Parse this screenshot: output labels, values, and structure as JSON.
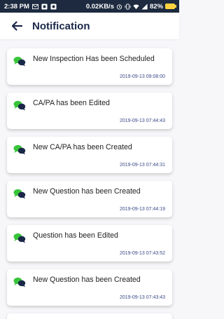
{
  "status_bar": {
    "time": "2:38 PM",
    "network_speed": "0.02KB/s",
    "battery": "82%"
  },
  "header": {
    "title": "Notification"
  },
  "notifications": [
    {
      "text": "New Inspection Has been Scheduled",
      "time": "2019-09-13 09:08:00"
    },
    {
      "text": "CA/PA has been Edited",
      "time": "2019-09-13 07:44:43"
    },
    {
      "text": "New CA/PA has been Created",
      "time": "2019-09-13 07:44:31"
    },
    {
      "text": "New Question has been Created",
      "time": "2019-09-13 07:44:19"
    },
    {
      "text": "Question has been Edited",
      "time": "2019-09-13 07:43:52"
    },
    {
      "text": "New Question has been Created",
      "time": "2019-09-13 07:43:43"
    }
  ]
}
